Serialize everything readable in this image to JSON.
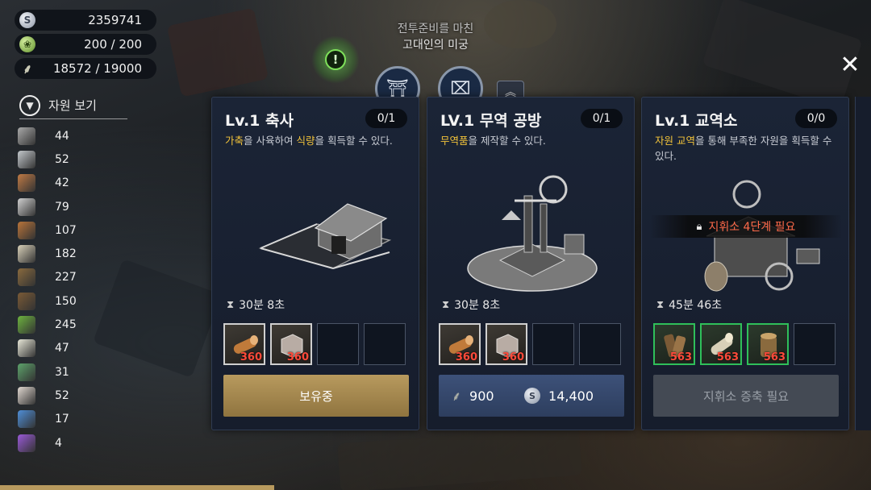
{
  "currency": [
    {
      "icon": "silver-coin-icon",
      "value": "2359741"
    },
    {
      "icon": "energy-icon",
      "value": "200 / 200"
    },
    {
      "icon": "wheat-icon",
      "value": "18572 / 19000"
    }
  ],
  "resource_view": {
    "label": "자원 보기"
  },
  "materials": [
    {
      "icon": "stone-block-icon",
      "color": "#a9a9a9",
      "count": "44"
    },
    {
      "icon": "silver-ore-icon",
      "color": "#c3c8cc",
      "count": "52"
    },
    {
      "icon": "copper-ore-icon",
      "color": "#c07a45",
      "count": "42"
    },
    {
      "icon": "feather-icon",
      "color": "#d0d0d0",
      "count": "79"
    },
    {
      "icon": "log-icon",
      "color": "#b8743a",
      "count": "107"
    },
    {
      "icon": "birch-log-icon",
      "color": "#d8d0b8",
      "count": "182"
    },
    {
      "icon": "stump-icon",
      "color": "#8a6a3e",
      "count": "227"
    },
    {
      "icon": "bark-icon",
      "color": "#7a5a36",
      "count": "150"
    },
    {
      "icon": "leaf-icon",
      "color": "#6db33f",
      "count": "245"
    },
    {
      "icon": "cotton-icon",
      "color": "#e8e8d8",
      "count": "47"
    },
    {
      "icon": "herb-icon",
      "color": "#5da36b",
      "count": "31"
    },
    {
      "icon": "egg-icon",
      "color": "#e0d8d0",
      "count": "52"
    },
    {
      "icon": "crystal-icon",
      "color": "#4f8fd8",
      "count": "17"
    },
    {
      "icon": "gem-icon",
      "color": "#9a5ad8",
      "count": "4"
    }
  ],
  "quest": {
    "line1": "전투준비를 마친",
    "line2": "고대인의 미궁"
  },
  "marker": {
    "glyph": "!"
  },
  "close": {
    "glyph": "✕"
  },
  "cards": [
    {
      "title": "Lv.1 축사",
      "count": "0/1",
      "desc_parts": [
        "가축",
        "을 사육하여 ",
        "식량",
        "을 획득할 수 있다."
      ],
      "time": "30분 8초",
      "slots": [
        {
          "filled": true,
          "icon": "log-icon",
          "qty": "360"
        },
        {
          "filled": true,
          "icon": "stone-block-icon",
          "qty": "360"
        },
        {
          "filled": false
        },
        {
          "filled": false
        }
      ],
      "action": {
        "label": "보유중"
      }
    },
    {
      "title": "LV.1 무역 공방",
      "count": "0/1",
      "desc_parts": [
        "무역품",
        "을 제작할 수 있다."
      ],
      "time": "30분 8초",
      "slots": [
        {
          "filled": true,
          "icon": "log-icon",
          "qty": "360"
        },
        {
          "filled": true,
          "icon": "stone-block-icon",
          "qty": "360"
        },
        {
          "filled": false
        },
        {
          "filled": false
        }
      ],
      "action": {
        "wheat_cost": "900",
        "silver_cost": "14,400"
      }
    },
    {
      "title": "Lv.1 교역소",
      "count": "0/0",
      "desc_parts": [
        "자원 교역",
        "을 통해 부족한 자원을 획득할 수 있다."
      ],
      "lock_text": "지휘소 4단계 필요",
      "time": "45분 46초",
      "slots": [
        {
          "filled": true,
          "icon": "bark-icon",
          "qty": "563"
        },
        {
          "filled": true,
          "icon": "birch-log-icon",
          "qty": "563"
        },
        {
          "filled": true,
          "icon": "stump-icon",
          "qty": "563"
        },
        {
          "filled": false
        }
      ],
      "action": {
        "label": "지휘소 증축 필요"
      }
    }
  ]
}
